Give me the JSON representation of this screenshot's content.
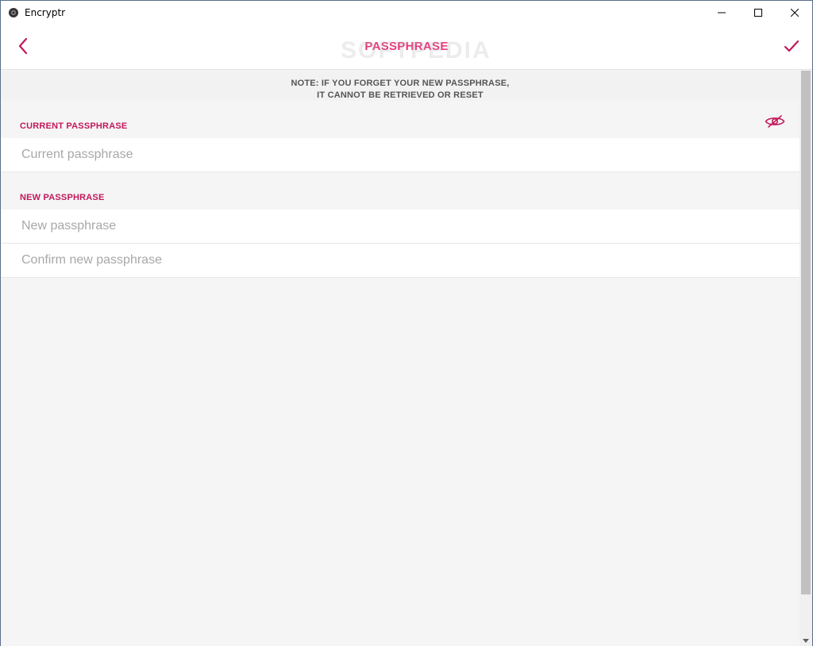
{
  "window": {
    "title": "Encryptr",
    "app_icon": "encryptr-logo-icon",
    "controls": [
      "minimize-icon",
      "maximize-icon",
      "close-icon"
    ]
  },
  "header": {
    "title": "PASSPHRASE",
    "back_icon": "chevron-left-icon",
    "confirm_icon": "checkmark-icon",
    "watermark": "SOFTPEDIA"
  },
  "note": {
    "line1": "NOTE: IF YOU FORGET YOUR NEW PASSPHRASE,",
    "line2": "IT CANNOT BE RETRIEVED OR RESET"
  },
  "current_section": {
    "label": "CURRENT PASSPHRASE",
    "field_placeholder": "Current passphrase",
    "field_value": ""
  },
  "new_section": {
    "label": "NEW PASSPHRASE",
    "toggle_icon": "eye-slash-icon",
    "new_placeholder": "New passphrase",
    "new_value": "",
    "confirm_placeholder": "Confirm new passphrase",
    "confirm_value": ""
  },
  "colors": {
    "accent": "#e6397b",
    "accent_dark": "#c2185b",
    "background": "#f5f5f5"
  }
}
